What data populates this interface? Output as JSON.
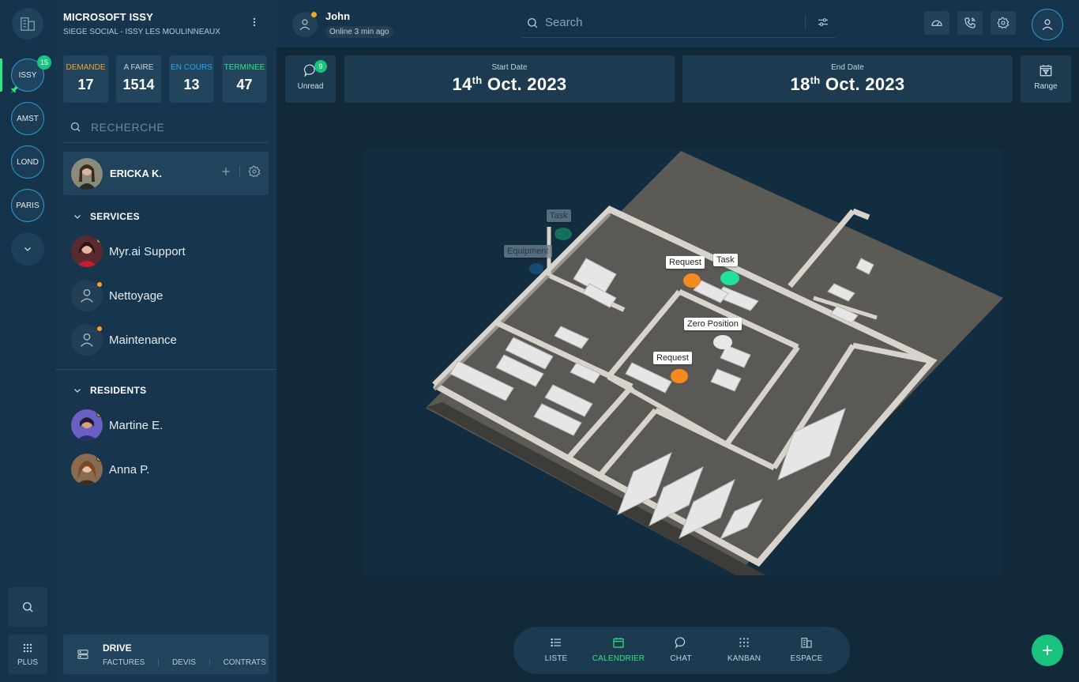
{
  "sites": {
    "items": [
      {
        "label": "ISSY"
      },
      {
        "label": "AMST"
      },
      {
        "label": "LOND"
      },
      {
        "label": "PARIS"
      }
    ],
    "active_badge": "15",
    "more_label": "PLUS"
  },
  "org": {
    "name": "MICROSOFT ISSY",
    "subtitle": "SIEGE SOCIAL - ISSY LES MOULINNEAUX"
  },
  "stats": [
    {
      "label": "DEMANDE",
      "value": "17",
      "color": "#f5a623"
    },
    {
      "label": "A FAIRE",
      "value": "1514",
      "color": "#c7d3dc"
    },
    {
      "label": "EN COURS",
      "value": "13",
      "color": "#2aa7e6"
    },
    {
      "label": "TERMINEE",
      "value": "47",
      "color": "#2ee685"
    }
  ],
  "panel": {
    "search_placeholder": "RECHERCHE",
    "current_user": "ERICKA K.",
    "services_title": "SERVICES",
    "services": [
      {
        "name": "Myr.ai Support"
      },
      {
        "name": "Nettoyage"
      },
      {
        "name": "Maintenance"
      }
    ],
    "residents_title": "RESIDENTS",
    "residents": [
      {
        "name": "Martine E."
      },
      {
        "name": "Anna P."
      }
    ]
  },
  "drive": {
    "title": "DRIVE",
    "links": [
      "FACTURES",
      "DEVIS",
      "CONTRATS"
    ]
  },
  "topbar": {
    "user_name": "John",
    "user_status": "Online 3 min ago",
    "search_placeholder": "Search"
  },
  "unread": {
    "count": "9",
    "label": "Unread"
  },
  "dates": {
    "start_label": "Start Date",
    "start_day": "14",
    "start_suffix": "th",
    "start_rest": "Oct. 2023",
    "end_label": "End Date",
    "end_day": "18",
    "end_suffix": "th",
    "end_rest": "Oct. 2023"
  },
  "range_label": "Range",
  "floorplan": {
    "markers": [
      {
        "label": "Task",
        "color": "#19c37d",
        "faded": true
      },
      {
        "label": "Equipment",
        "color": "#1f6fb5",
        "faded": true
      },
      {
        "label": "Request",
        "color": "#f58a1f",
        "faded": false
      },
      {
        "label": "Task",
        "color": "#1fe39a",
        "faded": false
      },
      {
        "label": "Zero Position",
        "color": "#e8e8e8",
        "faded": false
      },
      {
        "label": "Request",
        "color": "#f58a1f",
        "faded": false
      }
    ]
  },
  "bottom_nav": [
    {
      "label": "LISTE",
      "icon": "list-icon"
    },
    {
      "label": "CALENDRIER",
      "icon": "calendar-icon",
      "active": true
    },
    {
      "label": "CHAT",
      "icon": "chat-icon"
    },
    {
      "label": "KANBAN",
      "icon": "kanban-icon"
    },
    {
      "label": "ESPACE",
      "icon": "building-icon"
    }
  ],
  "colors": {
    "accent_green": "#19c37d",
    "accent_blue": "#2a9fd6",
    "accent_orange": "#f5a623"
  }
}
